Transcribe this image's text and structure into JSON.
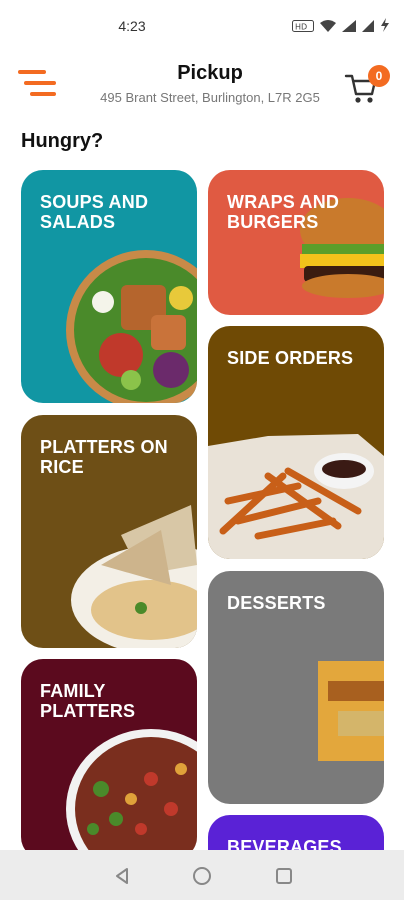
{
  "status_bar": {
    "time": "4:23"
  },
  "header": {
    "title": "Pickup",
    "address": "495 Brant Street, Burlington, L7R 2G5",
    "cart_count": "0",
    "accent_color": "#f36b21"
  },
  "section_title": "Hungry?",
  "categories": [
    {
      "label": "SOUPS AND SALADS",
      "color": "#1196a3"
    },
    {
      "label": "WRAPS AND BURGERS",
      "color": "#e05a42"
    },
    {
      "label": "SIDE ORDERS",
      "color": "#6f4a05"
    },
    {
      "label": "PLATTERS ON RICE",
      "color": "#6e4f16"
    },
    {
      "label": "DESSERTS",
      "color": "#7a7a7a"
    },
    {
      "label": "FAMILY PLATTERS",
      "color": "#5b0a1e"
    },
    {
      "label": "BEVERAGES",
      "color": "#5a22d6"
    }
  ],
  "icons": {
    "menu": "menu-icon",
    "cart": "cart-icon",
    "back": "back-icon",
    "home": "home-icon",
    "recents": "recents-icon"
  }
}
